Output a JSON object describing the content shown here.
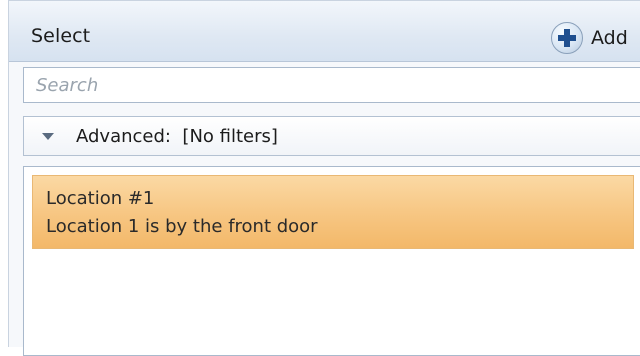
{
  "header": {
    "title": "Select",
    "add_label": "Add"
  },
  "search": {
    "placeholder": "Search",
    "value": ""
  },
  "filter": {
    "label": "Advanced:  [No filters]"
  },
  "list": {
    "items": [
      {
        "title": "Location #1",
        "description": "Location 1 is by the front door",
        "selected": true
      }
    ]
  },
  "colors": {
    "selection": "#f7c784",
    "header": "#dfe8f3",
    "border": "#a9b9cc"
  }
}
